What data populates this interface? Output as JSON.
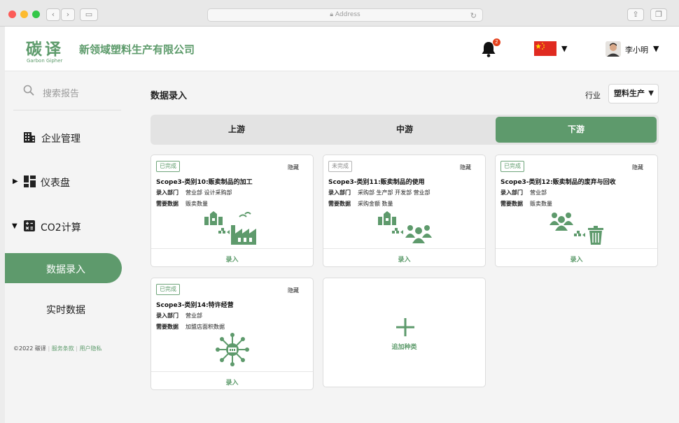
{
  "browser": {
    "address": "Address"
  },
  "header": {
    "logo_cn": "碳译",
    "logo_en": "Garbon Gipher",
    "company": "新领域塑料生产有限公司",
    "notification_count": "2",
    "language_flag": "cn-flag-icon",
    "user_name": "李小明"
  },
  "sidebar": {
    "search_placeholder": "搜索报告",
    "items": [
      {
        "label": "企业管理",
        "icon": "building-icon"
      },
      {
        "label": "仪表盘",
        "icon": "dashboard-icon"
      },
      {
        "label": "CO2计算",
        "icon": "calculator-icon"
      },
      {
        "label": "数据录入"
      },
      {
        "label": "实时数据"
      }
    ],
    "footer": {
      "copyright": "©2022 碳译",
      "terms": "服务条款",
      "privacy": "用户隐私"
    }
  },
  "main": {
    "title": "数据录入",
    "industry_label": "行业",
    "industry_value": "塑料生产",
    "tabs": [
      {
        "label": "上游"
      },
      {
        "label": "中游"
      },
      {
        "label": "下游",
        "active": true
      }
    ],
    "dept_label": "录入部门",
    "data_label": "需要数据",
    "hide_label": "隐藏",
    "entry_label": "录入",
    "cards": [
      {
        "status": "已完成",
        "title": "Scope3-类别10:贩卖制品的加工",
        "departments": "营业部  设计采购部",
        "data": "贩卖数量"
      },
      {
        "status": "未完成",
        "title": "Scope3-类别11:贩卖制品的使用",
        "departments": "采购部  生产部  开发部  营业部",
        "data": "采购金额  数量"
      },
      {
        "status": "已完成",
        "title": "Scope3-类别12:贩卖制品的废弃与回收",
        "departments": "营业部",
        "data": "贩卖数量"
      },
      {
        "status": "已完成",
        "title": "Scope3-类别14:特许经营",
        "departments": "营业部",
        "data": "加盟店面积数据"
      }
    ],
    "add_label": "追加种类"
  },
  "colors": {
    "brand_green": "#5e9a6c",
    "badge_red": "#e4411c",
    "flag_red": "#e02a20"
  }
}
